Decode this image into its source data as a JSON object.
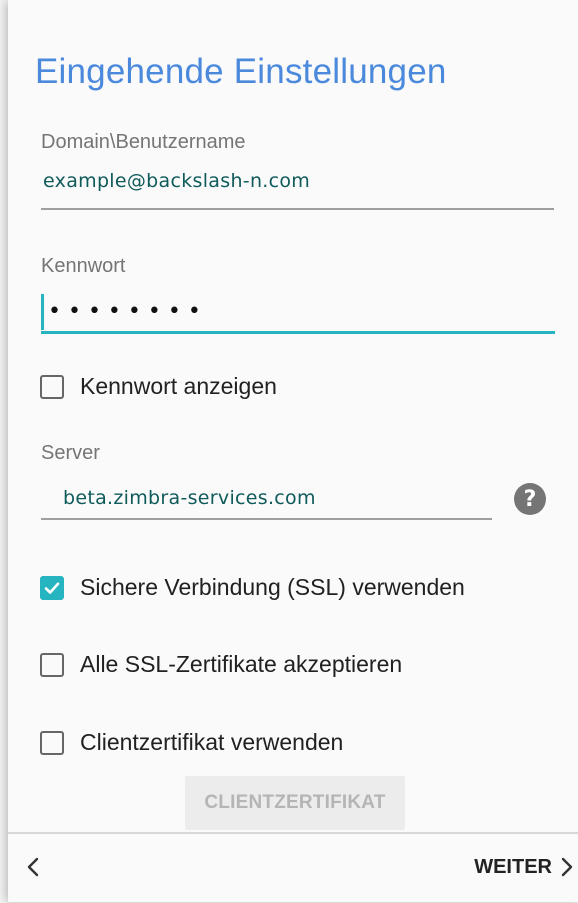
{
  "screen": {
    "title": "Eingehende Einstellungen"
  },
  "username": {
    "label": "Domain\\Benutzername",
    "value": "example@backslash-n.com"
  },
  "password": {
    "label": "Kennwort",
    "masked_value": "••••••••"
  },
  "show_password": {
    "label": "Kennwort anzeigen",
    "checked": false
  },
  "server": {
    "label": "Server",
    "value": "beta.zimbra-services.com",
    "help_icon": "help-circle-icon",
    "help_glyph": "?"
  },
  "ssl": {
    "label": "Sichere Verbindung (SSL) verwenden",
    "checked": true
  },
  "accept_all_ssl": {
    "label": "Alle SSL-Zertifikate akzeptieren",
    "checked": false
  },
  "client_cert": {
    "label": "Clientzertifikat verwenden",
    "checked": false,
    "button_label": "CLIENTZERTIFIKAT"
  },
  "nav": {
    "back_icon": "chevron-left-icon",
    "next_label": "WEITER",
    "next_icon": "chevron-right-icon"
  },
  "colors": {
    "title": "#4a89dc",
    "accent": "#26b5c0",
    "input_text": "#0f5a5a"
  }
}
